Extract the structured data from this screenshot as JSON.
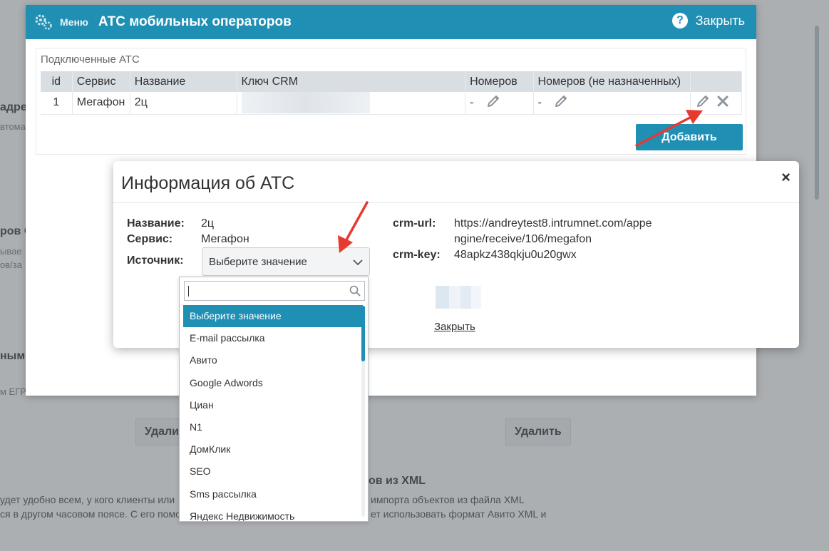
{
  "window": {
    "menu_label": "Меню",
    "title": "АТС мобильных операторов",
    "help_icon_glyph": "?",
    "close_label": "Закрыть",
    "accent_color": "#1f8fb4"
  },
  "connected": {
    "title": "Подключенные АТС",
    "columns": [
      "id",
      "Сервис",
      "Название",
      "Ключ CRM",
      "Номеров",
      "Номеров (не назначенных)"
    ],
    "rows": [
      {
        "id": "1",
        "service": "Мегафон",
        "name": "2ц",
        "numbers": "-",
        "unassigned": "-"
      }
    ],
    "add_button": "Добавить"
  },
  "modal": {
    "title": "Информация об АТС",
    "close_glyph": "×",
    "name_label": "Название:",
    "name_value": "2ц",
    "service_label": "Сервис:",
    "service_value": "Мегафон",
    "source_label": "Источник:",
    "source_value": "Выберите значение",
    "crm_url_label": "crm-url:",
    "crm_url_value": "https://andreytest8.intrumnet.com/appengine/receive/106/megafon",
    "crm_key_label": "crm-key:",
    "crm_key_value": "48apkz438qkju0u20gwx",
    "close_link": "Закрыть"
  },
  "dropdown": {
    "search_value": "",
    "options": [
      "Выберите значение",
      "E-mail рассылка",
      "Авито",
      "Google Adwords",
      "Циан",
      "N1",
      "ДомКлик",
      "SEO",
      "Sms рассылка",
      "Яндекс Недвижимость"
    ],
    "selected_index": 0
  },
  "background": {
    "fragments": [
      "адрес",
      "втома",
      "ров С",
      "ывае",
      "ов/за",
      "ным Е",
      "м ЕГРН",
      "ов из XML",
      "импорта объектов из файла XML",
      "ет использовать формат Авито XML и",
      "удет удобно всем, у кого клиенты или",
      "ся в другом часовом поясе. С его помо",
      "Удали",
      "Удалить"
    ]
  }
}
